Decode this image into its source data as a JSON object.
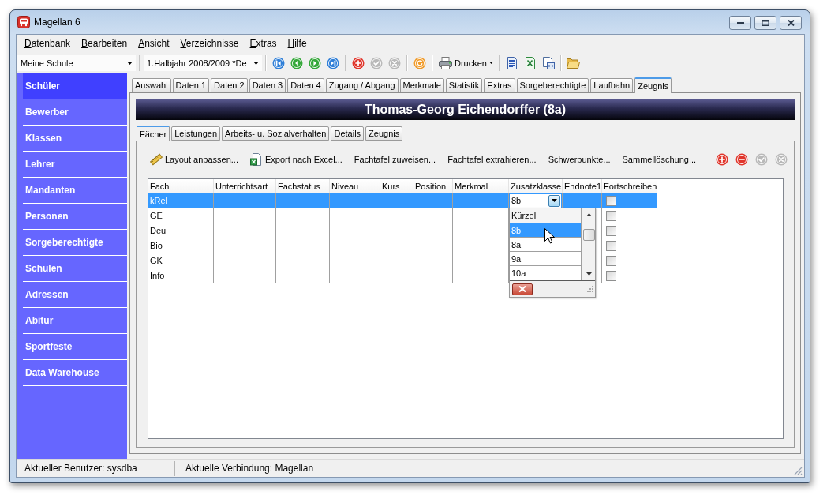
{
  "window": {
    "title": "Magellan 6"
  },
  "menu": [
    "Datenbank",
    "Bearbeiten",
    "Ansicht",
    "Verzeichnisse",
    "Extras",
    "Hilfe"
  ],
  "toolbar": {
    "school": "Meine Schule",
    "term": "1.Halbjahr 2008/2009 *De",
    "button_groups": [
      [
        {
          "kind": "first",
          "disabled": false
        },
        {
          "kind": "previous",
          "disabled": false
        },
        {
          "kind": "next",
          "disabled": false
        },
        {
          "kind": "last",
          "disabled": false
        }
      ],
      [
        {
          "kind": "add",
          "disabled": false
        },
        {
          "kind": "confirm",
          "disabled": true
        },
        {
          "kind": "cancel",
          "disabled": true
        }
      ],
      [
        {
          "kind": "refresh",
          "disabled": false
        }
      ]
    ],
    "print": "Drucken"
  },
  "sidebar": {
    "items": [
      {
        "label": "Schüler",
        "selected": true
      },
      {
        "label": "Bewerber",
        "selected": false
      },
      {
        "label": "Klassen",
        "selected": false
      },
      {
        "label": "Lehrer",
        "selected": false
      },
      {
        "label": "Mandanten",
        "selected": false
      },
      {
        "label": "Personen",
        "selected": false
      },
      {
        "label": "Sorgeberechtigte",
        "selected": false
      },
      {
        "label": "Schulen",
        "selected": false
      },
      {
        "label": "Adressen",
        "selected": false
      },
      {
        "label": "Abitur",
        "selected": false
      },
      {
        "label": "Sportfeste",
        "selected": false
      },
      {
        "label": "Data Warehouse",
        "selected": false
      }
    ]
  },
  "tabs": [
    {
      "label": "Auswahl",
      "selected": false
    },
    {
      "label": "Daten 1",
      "selected": false
    },
    {
      "label": "Daten 2",
      "selected": false
    },
    {
      "label": "Daten 3",
      "selected": false
    },
    {
      "label": "Daten 4",
      "selected": false
    },
    {
      "label": "Zugang / Abgang",
      "selected": false
    },
    {
      "label": "Merkmale",
      "selected": false
    },
    {
      "label": "Statistik",
      "selected": false
    },
    {
      "label": "Extras",
      "selected": false
    },
    {
      "label": "Sorgeberechtigte",
      "selected": false
    },
    {
      "label": "Laufbahn",
      "selected": false
    },
    {
      "label": "Zeugnis",
      "selected": true
    }
  ],
  "student": {
    "title": "Thomas-Georg Eichendorffer (8a)"
  },
  "subtabs": [
    {
      "label": "Fächer",
      "selected": true
    },
    {
      "label": "Leistungen",
      "selected": false
    },
    {
      "label": "Arbeits- u. Sozialverhalten",
      "selected": false
    },
    {
      "label": "Details",
      "selected": false
    },
    {
      "label": "Zeugnis",
      "selected": false
    }
  ],
  "grid_toolbar": {
    "actions": [
      {
        "kind": "layout",
        "label": "Layout anpassen..."
      },
      {
        "kind": "export",
        "label": "Export nach Excel..."
      },
      {
        "kind": "text",
        "label": "Fachtafel zuweisen..."
      },
      {
        "kind": "text",
        "label": "Fachtafel extrahieren..."
      },
      {
        "kind": "text",
        "label": "Schwerpunkte..."
      },
      {
        "kind": "text",
        "label": "Sammellöschung..."
      }
    ],
    "buttons": [
      {
        "kind": "add",
        "disabled": false
      },
      {
        "kind": "remove",
        "disabled": false
      },
      {
        "kind": "confirm",
        "disabled": true
      },
      {
        "kind": "cancel",
        "disabled": true
      }
    ]
  },
  "table": {
    "columns": [
      "Fach",
      "Unterrichtsart",
      "Fachstatus",
      "Niveau",
      "Kurs",
      "Position",
      "Merkmal",
      "Zusatzklasse",
      "Endnote1",
      "Fortschreiben"
    ],
    "rows": [
      {
        "subject": "kRel",
        "selected": true,
        "extra_class": "8b",
        "continues": false
      },
      {
        "subject": "GE",
        "selected": false,
        "continues": false
      },
      {
        "subject": "Deu",
        "selected": false,
        "continues": false
      },
      {
        "subject": "Bio",
        "selected": false,
        "continues": false
      },
      {
        "subject": "GK",
        "selected": false,
        "continues": false
      },
      {
        "subject": "Info",
        "selected": false,
        "continues": false
      }
    ]
  },
  "class_dropdown": {
    "header": "Kürzel",
    "items": [
      {
        "label": "8b",
        "selected": true
      },
      {
        "label": "8a",
        "selected": false
      },
      {
        "label": "9a",
        "selected": false
      },
      {
        "label": "10a",
        "selected": false
      }
    ]
  },
  "status_bar": [
    "Aktueller Benutzer: sysdba",
    "Aktuelle Verbindung: Magellan"
  ]
}
